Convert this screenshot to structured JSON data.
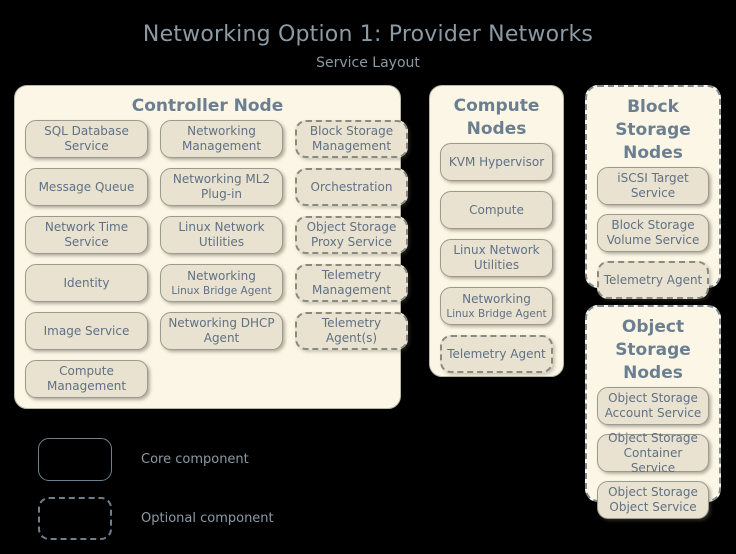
{
  "header": {
    "title": "Networking Option 1: Provider Networks",
    "subtitle": "Service Layout"
  },
  "panels": {
    "controller": {
      "title": "Controller Node",
      "optional_node": false,
      "columns": [
        [
          {
            "label": "SQL Database Service",
            "optional": false
          },
          {
            "label": "Message Queue",
            "optional": false
          },
          {
            "label": "Network Time Service",
            "optional": false
          },
          {
            "label": "Identity",
            "optional": false
          },
          {
            "label": "Image Service",
            "optional": false
          },
          {
            "label": "Compute Management",
            "optional": false
          }
        ],
        [
          {
            "label": "Networking Management",
            "optional": false
          },
          {
            "label": "Networking ML2 Plug-in",
            "optional": false
          },
          {
            "label": "Linux Network Utilities",
            "optional": false
          },
          {
            "label": "Networking",
            "sub": "Linux Bridge Agent",
            "optional": false
          },
          {
            "label": "Networking DHCP Agent",
            "optional": false
          }
        ],
        [
          {
            "label": "Block Storage Management",
            "optional": true
          },
          {
            "label": "Orchestration",
            "optional": true
          },
          {
            "label": "Object Storage Proxy Service",
            "optional": true
          },
          {
            "label": "Telemetry Management",
            "optional": true
          },
          {
            "label": "Telemetry Agent(s)",
            "optional": true
          }
        ]
      ]
    },
    "compute": {
      "title": "Compute Nodes",
      "optional_node": false,
      "items": [
        {
          "label": "KVM Hypervisor",
          "optional": false
        },
        {
          "label": "Compute",
          "optional": false
        },
        {
          "label": "Linux Network Utilities",
          "optional": false
        },
        {
          "label": "Networking",
          "sub": "Linux Bridge Agent",
          "optional": false
        },
        {
          "label": "Telemetry Agent",
          "optional": true
        }
      ]
    },
    "block_storage": {
      "title": "Block Storage Nodes",
      "optional_node": true,
      "items": [
        {
          "label": "iSCSI Target Service",
          "optional": false
        },
        {
          "label": "Block Storage Volume Service",
          "optional": false
        },
        {
          "label": "Telemetry Agent",
          "optional": true
        }
      ]
    },
    "object_storage": {
      "title": "Object Storage Nodes",
      "optional_node": true,
      "items": [
        {
          "label": "Object Storage Account Service",
          "optional": false
        },
        {
          "label": "Object Storage Container Service",
          "optional": false
        },
        {
          "label": "Object Storage Object Service",
          "optional": false
        }
      ]
    }
  },
  "legend": {
    "core_label": "Core component",
    "optional_label": "Optional component"
  },
  "colors": {
    "background": "#000000",
    "panel_fill": "#fbf6e6",
    "box_fill": "#e9e2d0",
    "title_text": "#8b9aa5",
    "panel_title_text": "#6b7f90",
    "box_text": "#5f7183",
    "dash_border": "#8a8a80"
  }
}
